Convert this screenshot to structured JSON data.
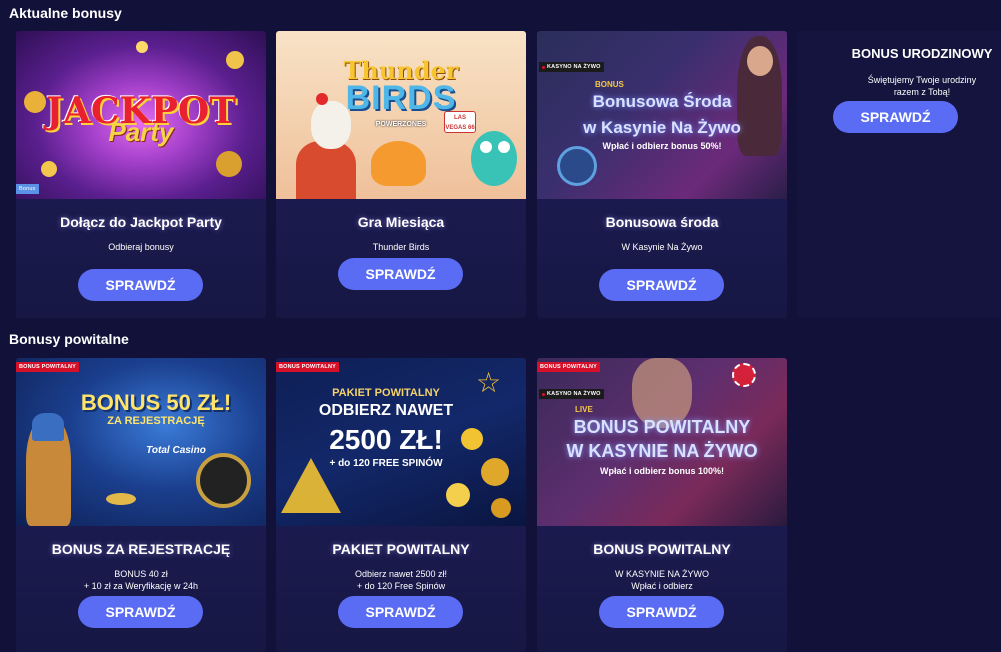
{
  "sections": {
    "current": "Aktualne bonusy",
    "welcome": "Bonusy powitalne"
  },
  "cta_label": "SPRAWDŹ",
  "colors": {
    "background": "#12113a",
    "button": "#5a6cf3",
    "badge_red": "#d7102a"
  },
  "current_bonuses": [
    {
      "title": "Dołącz do Jackpot Party",
      "subtitle": "Odbieraj bonusy",
      "badge": "Bonus",
      "banner": {
        "line1": "JACKPOT",
        "line2": "Party"
      }
    },
    {
      "title": "Gra Miesiąca",
      "subtitle": "Thunder Birds",
      "banner": {
        "line1": "Thunder",
        "line2": "BIRDS",
        "line3": "POWERZONES",
        "sign": "LAS VEGAS 66"
      }
    },
    {
      "title": "Bonusowa środa",
      "subtitle": "W Kasynie Na Żywo",
      "badge": "KASYNO NA ŻYWO",
      "banner": {
        "kicker": "BONUS",
        "line1": "Bonusowa Środa",
        "line2": "w Kasynie Na Żywo",
        "line3": "Wpłać i odbierz bonus 50%!"
      }
    }
  ],
  "birthday": {
    "title": "BONUS URODZINOWY",
    "subtitle_1": "Świętujemy Twoje urodziny",
    "subtitle_2": "razem z Tobą!"
  },
  "welcome_bonuses": [
    {
      "title": "BONUS ZA REJESTRACJĘ",
      "subtitle_1": "BONUS 40 zł",
      "subtitle_2": "+ 10 zł za Weryfikację w 24h",
      "badge": "BONUS POWITALNY",
      "banner": {
        "line1": "BONUS 50 ZŁ!",
        "line2": "ZA REJESTRACJĘ",
        "logo": "Total Casino"
      }
    },
    {
      "title": "PAKIET POWITALNY",
      "subtitle_1": "Odbierz nawet 2500 zł!",
      "subtitle_2": "+ do 120 Free Spinów",
      "badge": "BONUS POWITALNY",
      "banner": {
        "line0": "PAKIET POWITALNY",
        "line1": "ODBIERZ NAWET",
        "line2": "2500 ZŁ!",
        "line3": "+ do 120 FREE SPINÓW"
      }
    },
    {
      "title": "BONUS POWITALNY",
      "subtitle_1": "W KASYNIE NA ŻYWO",
      "subtitle_2": "Wpłać i odbierz",
      "badge": "BONUS POWITALNY",
      "badge2": "KASYNO NA ŻYWO",
      "banner": {
        "kicker": "LIVE",
        "line1": "BONUS POWITALNY",
        "line2": "W KASYNIE NA ŻYWO",
        "line3": "Wpłać i odbierz bonus 100%!"
      }
    }
  ]
}
